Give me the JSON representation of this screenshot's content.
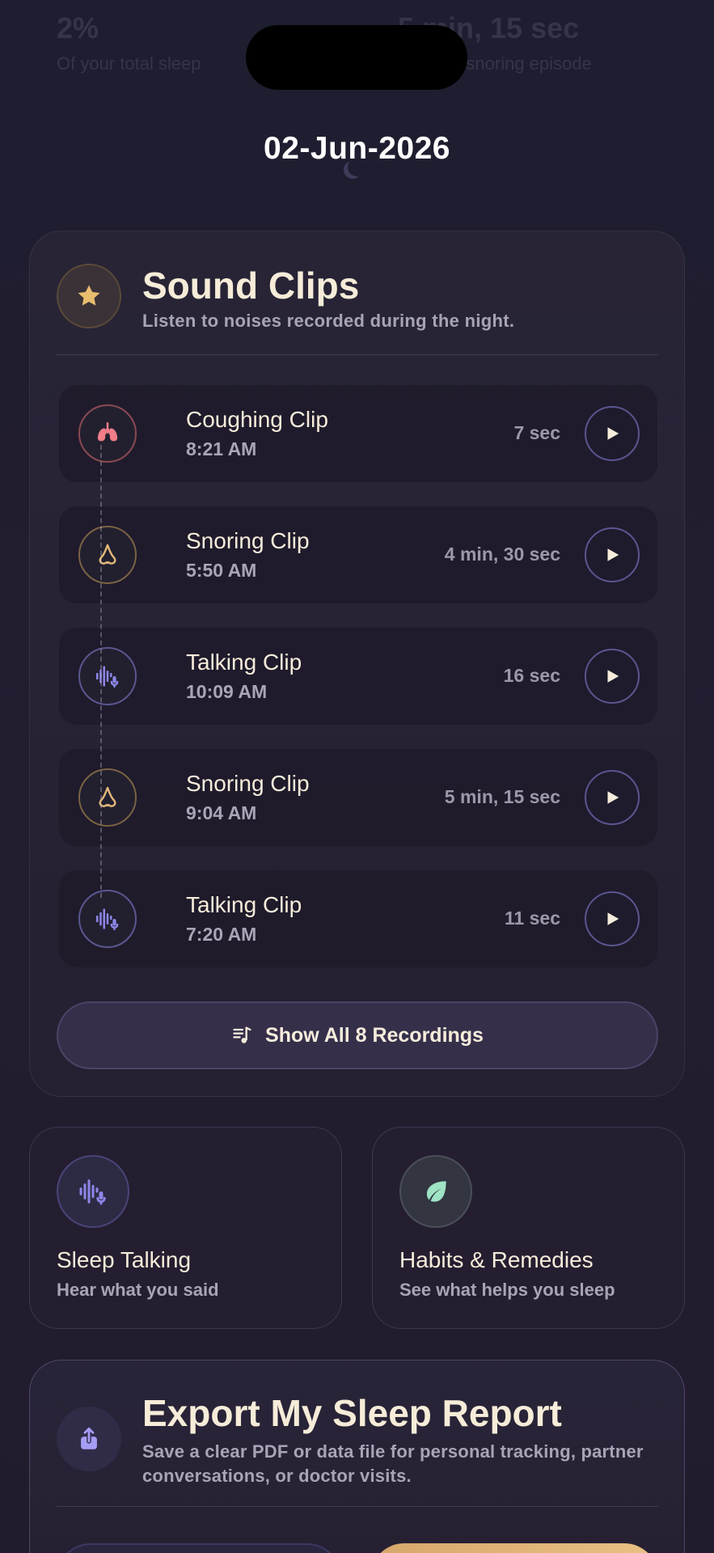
{
  "header": {
    "faded_stat_left_value": "2%",
    "faded_stat_left_label": "Of your total sleep",
    "faded_stat_right_value": "5 min, 15 sec",
    "faded_stat_right_label": "Longest snoring episode",
    "date": "02-Jun-2026"
  },
  "sound_clips": {
    "title": "Sound Clips",
    "subtitle": "Listen to noises recorded during the night.",
    "clips": [
      {
        "name": "Coughing Clip",
        "time": "8:21 AM",
        "duration": "7 sec",
        "icon": "lungs-icon"
      },
      {
        "name": "Snoring Clip",
        "time": "5:50 AM",
        "duration": "4 min, 30 sec",
        "icon": "nose-icon"
      },
      {
        "name": "Talking Clip",
        "time": "10:09 AM",
        "duration": "16 sec",
        "icon": "voice-wave-icon"
      },
      {
        "name": "Snoring Clip",
        "time": "9:04 AM",
        "duration": "5 min, 15 sec",
        "icon": "nose-icon"
      },
      {
        "name": "Talking Clip",
        "time": "7:20 AM",
        "duration": "11 sec",
        "icon": "voice-wave-icon"
      }
    ],
    "show_all_label": "Show All 8 Recordings"
  },
  "tiles": {
    "sleep_talking": {
      "title": "Sleep Talking",
      "subtitle": "Hear what you said"
    },
    "habits": {
      "title": "Habits & Remedies",
      "subtitle": "See what helps you sleep"
    }
  },
  "export": {
    "title": "Export My Sleep Report",
    "subtitle": "Save a clear PDF or data file for personal tracking, partner conversations, or doctor visits."
  },
  "colors": {
    "accent_gold": "#e2b978",
    "accent_purple": "#8d86e8",
    "cough_red": "#f07d88",
    "leaf_green": "#9fe3c4"
  }
}
